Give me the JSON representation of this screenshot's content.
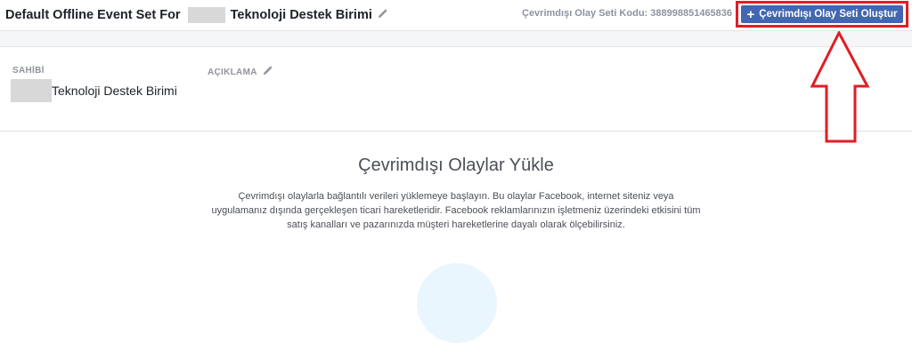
{
  "header": {
    "title_prefix": "Default Offline Event Set For",
    "title_suffix": "Teknoloji Destek Birimi",
    "code_label": "Çevrimdışı Olay Seti Kodu:",
    "code_value": "388998851465836",
    "create_button_label": "Çevrimdışı Olay Seti Oluştur"
  },
  "details": {
    "owner_label": "SAHİBİ",
    "owner_value": "Teknoloji Destek Birimi",
    "description_label": "AÇIKLAMA"
  },
  "upload": {
    "title": "Çevrimdışı Olaylar Yükle",
    "description": "Çevrimdışı olaylarla bağlantılı verileri yüklemeye başlayın. Bu olaylar Facebook, internet siteniz veya uygulamanız dışında gerçekleşen ticari hareketleridir. Facebook reklamlarınızın işletmeniz üzerindeki etkisini tüm satış kanalları ve pazarınızda müşteri hareketlerine dayalı olarak ölçebilirsiniz."
  },
  "colors": {
    "button_blue": "#4267b2",
    "annotation_red": "#e01e24"
  },
  "icons": {
    "edit": "pencil-icon",
    "create": "plus-icon",
    "annotation": "up-arrow"
  }
}
